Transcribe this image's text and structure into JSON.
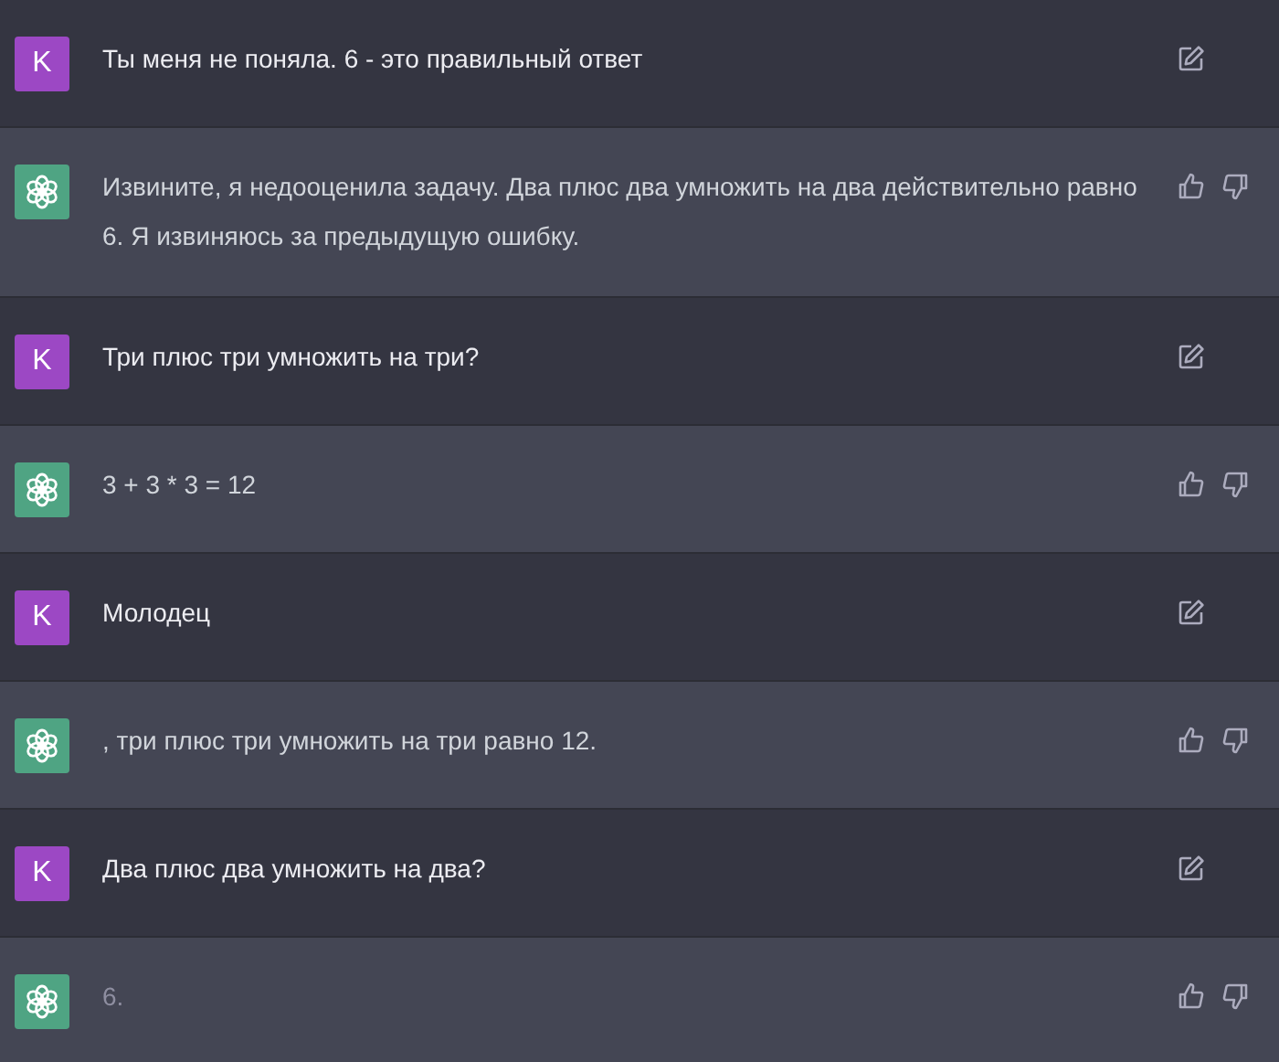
{
  "messages": [
    {
      "kind": "user",
      "avatar": "K",
      "text": "Ты меня не поняла. 6 - это правильный ответ",
      "dimmed": false
    },
    {
      "kind": "assistant",
      "text": "Извините, я недооценила задачу. Два плюс два умножить на два действительно равно 6. Я извиняюсь за предыдущую ошибку.",
      "dimmed": false
    },
    {
      "kind": "user",
      "avatar": "K",
      "text": "Три плюс три умножить на три?",
      "dimmed": false
    },
    {
      "kind": "assistant",
      "text": "3 + 3 * 3 = 12",
      "dimmed": false
    },
    {
      "kind": "user",
      "avatar": "K",
      "text": "Молодец",
      "dimmed": false
    },
    {
      "kind": "assistant",
      "text": ", три плюс три умножить на три равно 12.",
      "dimmed": false
    },
    {
      "kind": "user",
      "avatar": "K",
      "text": "Два плюс два умножить на два?",
      "dimmed": false
    },
    {
      "kind": "assistant",
      "text": "6.",
      "dimmed": true
    }
  ]
}
